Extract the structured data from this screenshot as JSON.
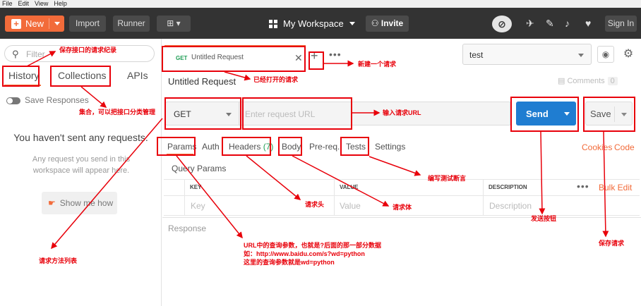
{
  "menubar": {
    "items": [
      "File",
      "Edit",
      "View",
      "Help"
    ]
  },
  "toolbar": {
    "new_label": "New",
    "import_label": "Import",
    "runner_label": "Runner",
    "workspace_label": "My Workspace",
    "invite_label": "Invite",
    "signin_label": "Sign In",
    "icons": [
      "sync-off-icon",
      "satellite-icon",
      "wrench-icon",
      "bell-icon",
      "heart-icon"
    ]
  },
  "sidebar": {
    "filter_placeholder": "Filter",
    "tabs": [
      "History",
      "Collections",
      "APIs"
    ],
    "active_tab": "History",
    "save_responses_label": "Save Responses",
    "empty_title": "You haven't sent any requests.",
    "empty_sub": "Any request you send in this workspace will appear here.",
    "show_me_label": "Show me how"
  },
  "request_tab": {
    "method": "GET",
    "title": "Untitled Request"
  },
  "environment": {
    "selected": "test"
  },
  "request": {
    "name": "Untitled Request",
    "comments_label": "Comments",
    "comments_count": "0",
    "method": "GET",
    "url_placeholder": "Enter request URL",
    "send_label": "Send",
    "save_label": "Save"
  },
  "param_tabs": {
    "params": "Params",
    "auth": "Auth",
    "headers": "Headers",
    "headers_count": "(7)",
    "body": "Body",
    "prereq": "Pre-req.",
    "tests": "Tests",
    "settings": "Settings",
    "cookies": "Cookies",
    "code": "Code"
  },
  "query_params": {
    "title": "Query Params",
    "columns": [
      "KEY",
      "VALUE",
      "DESCRIPTION"
    ],
    "bulk_edit": "Bulk Edit",
    "row_placeholders": [
      "Key",
      "Value",
      "Description"
    ]
  },
  "response": {
    "label": "Response"
  },
  "annotations": {
    "history": "保存接口的请求纪录",
    "collections": "集合，可以把接口分类管理",
    "opened": "已经打开的请求",
    "new_request": "新建一个请求",
    "url": "输入请求URL",
    "tests": "编写测试断言",
    "headers": "请求头",
    "body": "请求体",
    "send": "发送按钮",
    "save": "保存请求",
    "method_list": "请求方法列表",
    "params_line1": "URL中的查询参数，也就是?后面的那一部分数据",
    "params_line2": "如：http://www.baidu.com/s?wd=python",
    "params_line3": "这里的查询参数就是wd=python"
  },
  "colors": {
    "accent": "#f26b3a",
    "send": "#1f7dd1",
    "annotation": "#e8000a",
    "topbar": "#333333"
  }
}
